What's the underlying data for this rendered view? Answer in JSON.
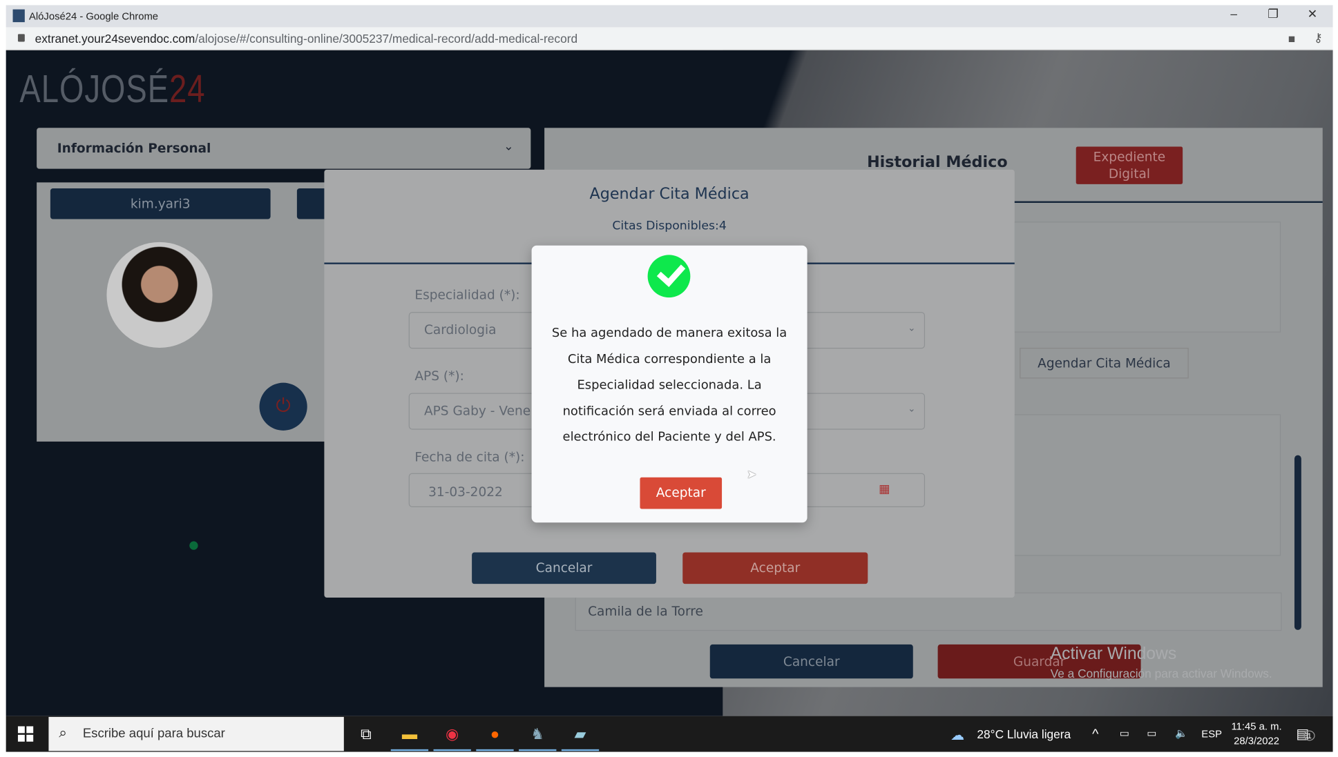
{
  "browser": {
    "title": "AlóJosé24 - Google Chrome",
    "url_host": "extranet.your24sevendoc.com",
    "url_path": "/alojose/#/consulting-online/3005237/medical-record/add-medical-record"
  },
  "logo": {
    "main": "ALÓJOSÉ",
    "accent": "24"
  },
  "left_panel": {
    "header": "Información Personal",
    "username": "kim.yari3"
  },
  "history": {
    "title": "Historial Médico",
    "expediente": "Expediente Digital",
    "agendar": "Agendar Cita Médica",
    "name_value": "Camila de la Torre",
    "cancel": "Cancelar",
    "save": "Guardar"
  },
  "modal": {
    "title": "Agendar Cita Médica",
    "citas": "Citas Disponibles:4",
    "especialidad_label": "Especialidad (*):",
    "especialidad_value": "Cardiologia",
    "aps_label": "APS (*):",
    "aps_value": "APS Gaby - Vene",
    "fecha_label": "Fecha de cita (*):",
    "fecha_value": "31-03-2022",
    "cancel": "Cancelar",
    "accept": "Aceptar"
  },
  "alert": {
    "message": "Se ha agendado de manera exitosa la Cita Médica correspondiente a la Especialidad seleccionada. La notificación será enviada al correo electrónico del Paciente y del APS.",
    "ok": "Aceptar"
  },
  "watermark": {
    "title": "Activar Windows",
    "subtitle": "Ve a Configuración para activar Windows."
  },
  "taskbar": {
    "search_placeholder": "Escribe aquí para buscar",
    "weather": "28°C  Lluvia ligera",
    "lang": "ESP",
    "time": "11:45 a. m.",
    "date": "28/3/2022",
    "notifications": "1"
  }
}
